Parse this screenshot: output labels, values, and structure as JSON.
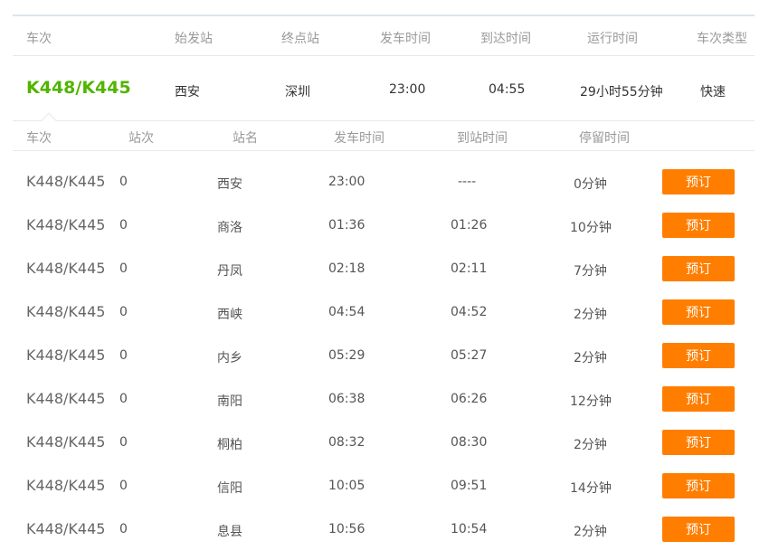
{
  "summary": {
    "headers": [
      "车次",
      "始发站",
      "终点站",
      "发车时间",
      "到达时间",
      "运行时间",
      "车次类型"
    ],
    "train_no": "K448/K445",
    "from": "西安",
    "to": "深圳",
    "depart": "23:00",
    "arrive": "04:55",
    "duration": "29小时55分钟",
    "type": "快速"
  },
  "detail": {
    "headers": [
      "车次",
      "站次",
      "站名",
      "发车时间",
      "到站时间",
      "停留时间"
    ],
    "book_label": "预订",
    "rows": [
      {
        "train": "K448/K445",
        "seq": "0",
        "station": "西安",
        "depart": "23:00",
        "arrive": "----",
        "stay": "0分钟"
      },
      {
        "train": "K448/K445",
        "seq": "0",
        "station": "商洛",
        "depart": "01:36",
        "arrive": "01:26",
        "stay": "10分钟"
      },
      {
        "train": "K448/K445",
        "seq": "0",
        "station": "丹凤",
        "depart": "02:18",
        "arrive": "02:11",
        "stay": "7分钟"
      },
      {
        "train": "K448/K445",
        "seq": "0",
        "station": "西峡",
        "depart": "04:54",
        "arrive": "04:52",
        "stay": "2分钟"
      },
      {
        "train": "K448/K445",
        "seq": "0",
        "station": "内乡",
        "depart": "05:29",
        "arrive": "05:27",
        "stay": "2分钟"
      },
      {
        "train": "K448/K445",
        "seq": "0",
        "station": "南阳",
        "depart": "06:38",
        "arrive": "06:26",
        "stay": "12分钟"
      },
      {
        "train": "K448/K445",
        "seq": "0",
        "station": "桐柏",
        "depart": "08:32",
        "arrive": "08:30",
        "stay": "2分钟"
      },
      {
        "train": "K448/K445",
        "seq": "0",
        "station": "信阳",
        "depart": "10:05",
        "arrive": "09:51",
        "stay": "14分钟"
      },
      {
        "train": "K448/K445",
        "seq": "0",
        "station": "息县",
        "depart": "10:56",
        "arrive": "10:54",
        "stay": "2分钟"
      }
    ]
  }
}
